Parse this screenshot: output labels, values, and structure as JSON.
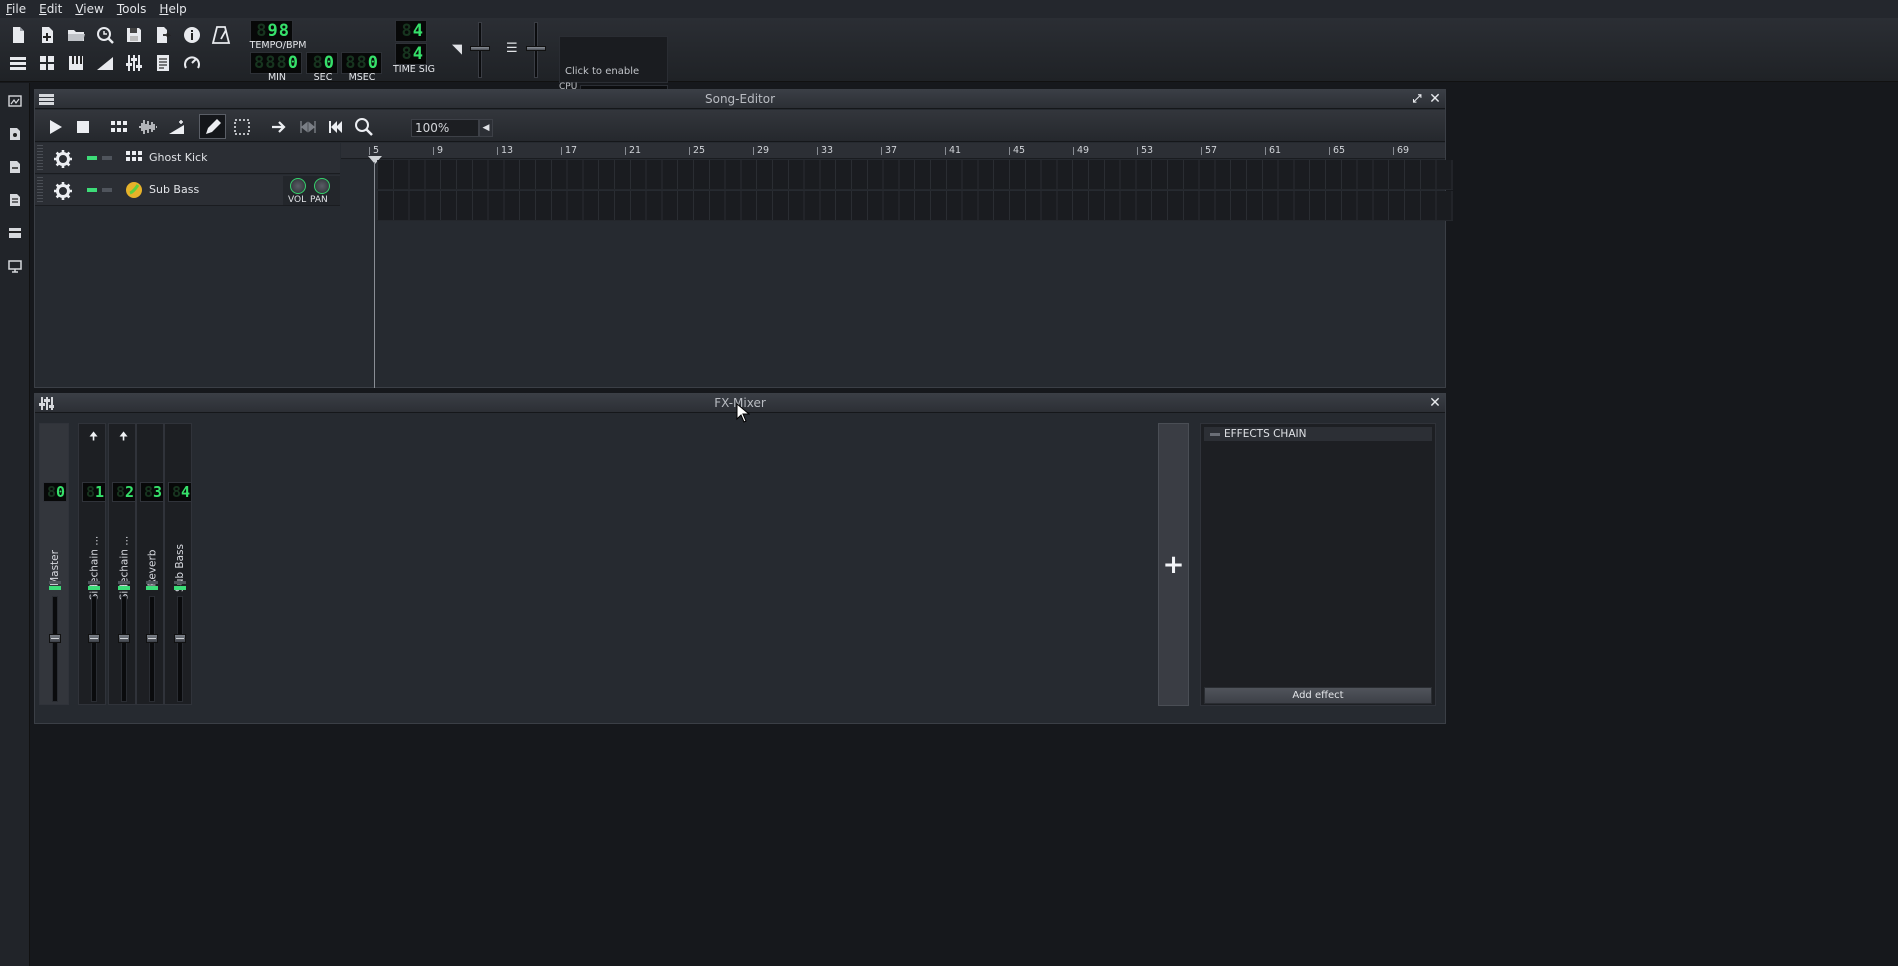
{
  "menu": [
    "File",
    "Edit",
    "View",
    "Tools",
    "Help"
  ],
  "toolbar": {
    "tempo": {
      "value": "98",
      "label": "TEMPO/BPM"
    },
    "time": {
      "min": "0",
      "sec": "0",
      "msec": "0",
      "min_label": "MIN",
      "sec_label": "SEC",
      "msec_label": "MSEC"
    },
    "time_sig": {
      "numerator": "4",
      "denominator": "4",
      "label": "TIME SIG"
    },
    "cpu": {
      "hint": "Click to enable",
      "label": "CPU"
    }
  },
  "song_editor": {
    "title": "Song-Editor",
    "zoom": "100%",
    "bars": [
      "5",
      "9",
      "13",
      "17",
      "21",
      "25",
      "29",
      "33",
      "37",
      "41",
      "45",
      "49",
      "53",
      "57",
      "61",
      "65",
      "69"
    ],
    "tracks": [
      {
        "name": "Ghost Kick",
        "icon": "beat-grid-icon"
      },
      {
        "name": "Sub Bass",
        "icon": "instrument-icon",
        "knob_labels": [
          "VOL",
          "PAN"
        ]
      }
    ]
  },
  "fx_mixer": {
    "title": "FX-Mixer",
    "channels": [
      {
        "num": "0",
        "name": "Master",
        "send": false
      },
      {
        "num": "1",
        "name": "Sidechain ...",
        "send": true
      },
      {
        "num": "2",
        "name": "Sidechain ...",
        "send": true
      },
      {
        "num": "3",
        "name": "Reverb",
        "send": false
      },
      {
        "num": "4",
        "name": "Sub Bass",
        "send": false
      }
    ],
    "effects_chain": {
      "title": "EFFECTS CHAIN",
      "add_label": "Add effect"
    },
    "add_channel_label": "+"
  },
  "colors": {
    "lcd_green": "#36e06a",
    "led_green": "#3ddc78",
    "background": "#16181c"
  }
}
